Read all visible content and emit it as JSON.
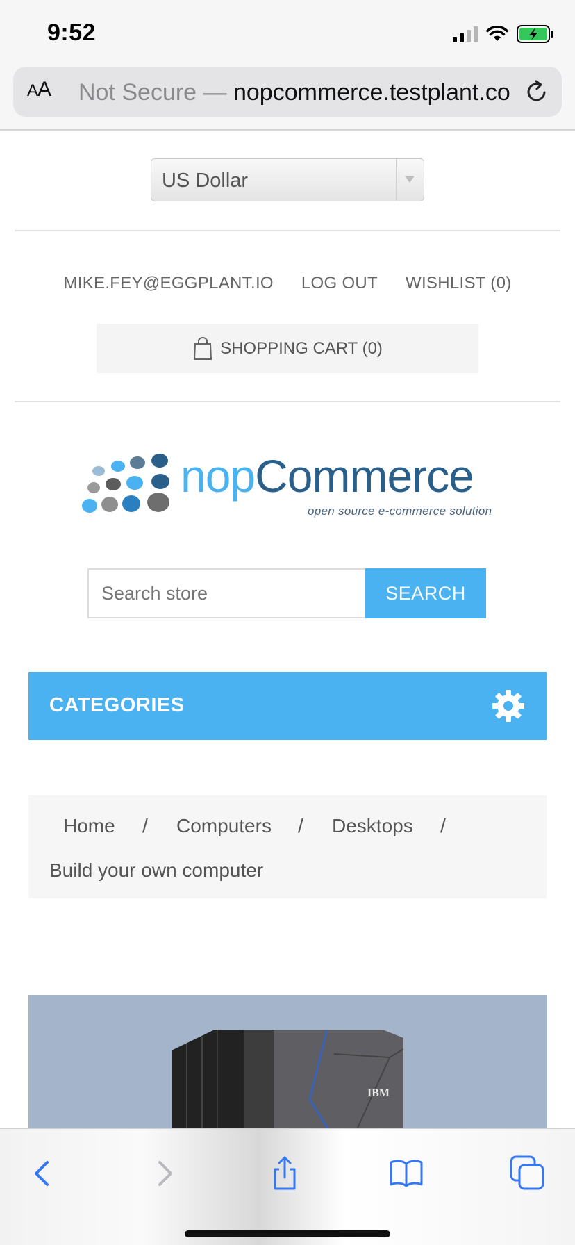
{
  "status_bar": {
    "time": "9:52"
  },
  "browser": {
    "text_size_label": "AA",
    "url_prefix": "Not Secure — ",
    "url_host": "nopcommerce.testplant.co"
  },
  "header": {
    "currency": {
      "selected": "US Dollar"
    },
    "links": {
      "account": "MIKE.FEY@EGGPLANT.IO",
      "logout": "LOG OUT",
      "wishlist": "WISHLIST (0)"
    },
    "cart_label": "SHOPPING CART (0)"
  },
  "logo": {
    "name_part1": "nop",
    "name_part2": "Commerce",
    "tagline": "open source e-commerce solution"
  },
  "search": {
    "placeholder": "Search store",
    "button_label": "SEARCH"
  },
  "categories": {
    "label": "CATEGORIES"
  },
  "breadcrumb": {
    "items": [
      "Home",
      "Computers",
      "Desktops"
    ],
    "separator": "/",
    "current": "Build your own computer"
  },
  "product": {
    "brand": "IBM"
  },
  "colors": {
    "accent": "#4ab2f1",
    "logo_dark": "#2a5f8a",
    "toolbar_icon": "#3478f6"
  },
  "toolbar": {
    "icons": [
      "back-icon",
      "forward-icon",
      "share-icon",
      "bookmarks-icon",
      "tabs-icon"
    ]
  }
}
